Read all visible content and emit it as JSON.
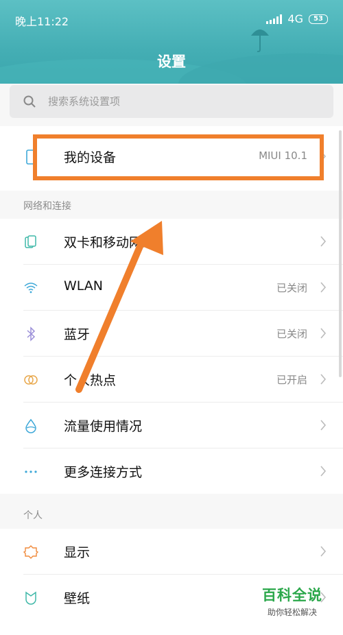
{
  "status_bar": {
    "time": "晚上11:22",
    "network": "4G",
    "network_sub": "ᵢₗ",
    "battery": "53"
  },
  "header": {
    "title": "设置"
  },
  "search": {
    "placeholder": "搜索系统设置项"
  },
  "my_device": {
    "label": "我的设备",
    "value": "MIUI 10.1",
    "icon": "phone-icon"
  },
  "sections": {
    "network": {
      "title": "网络和连接",
      "items": [
        {
          "label": "双卡和移动网络",
          "value": "",
          "icon": "sim-card-icon",
          "color": "#3fb8a8"
        },
        {
          "label": "WLAN",
          "value": "已关闭",
          "icon": "wifi-icon",
          "color": "#3ea8d8"
        },
        {
          "label": "蓝牙",
          "value": "已关闭",
          "icon": "bluetooth-icon",
          "color": "#9b8fd8"
        },
        {
          "label": "个人热点",
          "value": "已开启",
          "icon": "hotspot-icon",
          "color": "#e8a74a"
        },
        {
          "label": "流量使用情况",
          "value": "",
          "icon": "data-usage-icon",
          "color": "#3ea8d8"
        },
        {
          "label": "更多连接方式",
          "value": "",
          "icon": "more-dots-icon",
          "color": "#3ea8d8"
        }
      ]
    },
    "personal": {
      "title": "个人",
      "items": [
        {
          "label": "显示",
          "value": "",
          "icon": "display-icon",
          "color": "#f08a3c"
        },
        {
          "label": "壁纸",
          "value": "",
          "icon": "wallpaper-icon",
          "color": "#3fb8a8"
        }
      ]
    }
  },
  "watermark": {
    "main": "百科全说",
    "sub": "助你轻松解决"
  },
  "colors": {
    "header": "#44aeb4",
    "highlight": "#f07f2c",
    "watermark": "#2aa74a"
  }
}
